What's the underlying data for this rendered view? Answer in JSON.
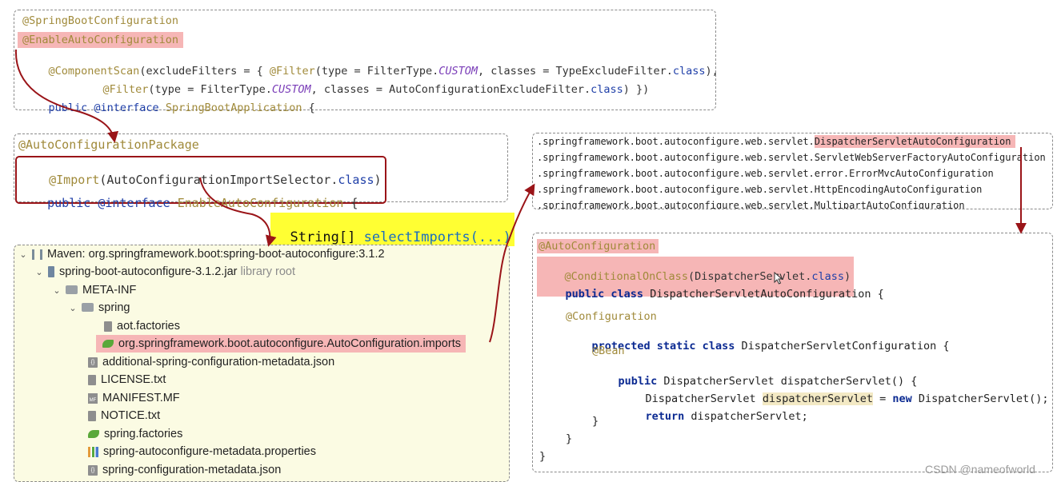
{
  "box1": {
    "ann_springbootconfiguration": "@SpringBootConfiguration",
    "ann_enableautoconfiguration": "@EnableAutoConfiguration",
    "componentscan": {
      "a": "@ComponentScan",
      "b": "(excludeFilters = { ",
      "c": "@Filter",
      "d": "(type = FilterType.",
      "e": "CUSTOM",
      "f": ", classes = TypeExcludeFilter.",
      "g": "class",
      "h": "),"
    },
    "filter2": {
      "a": "@Filter",
      "b": "(type = FilterType.",
      "c": "CUSTOM",
      "d": ", classes = AutoConfigurationExcludeFilter.",
      "e": "class",
      "f": ") })"
    },
    "decl": {
      "a": "public @interface ",
      "b": "SpringBootApplication",
      "c": " {"
    }
  },
  "box2": {
    "ann_package": "@AutoConfigurationPackage",
    "import": {
      "a": "@Import",
      "b": "(AutoConfigurationImportSelector.",
      "c": "class",
      "d": ")"
    },
    "decl": {
      "a": "public @interface ",
      "b": "EnableAutoConfiguration",
      "c": " {"
    }
  },
  "select_imports_label": {
    "a": "String[] ",
    "b": "selectImports(...)"
  },
  "tree": {
    "items": [
      {
        "chev": "⌄",
        "label": "Maven: org.springframework.boot:spring-boot-autoconfigure:3.1.2",
        "extra": ""
      },
      {
        "chev": "⌄",
        "label": "spring-boot-autoconfigure-3.1.2.jar",
        "extra": "library root"
      },
      {
        "chev": "⌄",
        "label": "META-INF",
        "extra": ""
      },
      {
        "chev": "⌄",
        "label": "spring",
        "extra": ""
      },
      {
        "chev": "",
        "label": "aot.factories",
        "extra": ""
      },
      {
        "chev": "",
        "label": "org.springframework.boot.autoconfigure.AutoConfiguration.imports",
        "extra": ""
      },
      {
        "chev": "",
        "label": "additional-spring-configuration-metadata.json",
        "extra": ""
      },
      {
        "chev": "",
        "label": "LICENSE.txt",
        "extra": ""
      },
      {
        "chev": "",
        "label": "MANIFEST.MF",
        "extra": ""
      },
      {
        "chev": "",
        "label": "NOTICE.txt",
        "extra": ""
      },
      {
        "chev": "",
        "label": "spring.factories",
        "extra": ""
      },
      {
        "chev": "",
        "label": "spring-autoconfigure-metadata.properties",
        "extra": ""
      },
      {
        "chev": "",
        "label": "spring-configuration-metadata.json",
        "extra": ""
      }
    ]
  },
  "imports_list": {
    "prefix": ".springframework.boot.autoconfigure.web.servlet.",
    "lines": [
      "DispatcherServletAutoConfiguration",
      "ServletWebServerFactoryAutoConfiguration",
      "error.ErrorMvcAutoConfiguration",
      "HttpEncodingAutoConfiguration",
      "MultipartAutoConfiguration"
    ]
  },
  "box4": {
    "ann_autoconfiguration": "@AutoConfiguration",
    "conditional": {
      "a": "@ConditionalOnClass",
      "b": "(DispatcherServlet.",
      "c": "class",
      "d": ")"
    },
    "class_decl": {
      "a": "public class ",
      "b": "DispatcherServletAutoConfiguration {"
    },
    "configuration_ann": "@Configuration",
    "inner_decl": {
      "a": "protected static class ",
      "b": "DispatcherServletConfiguration {"
    },
    "bean_ann": "@Bean",
    "method_decl": {
      "a": "public ",
      "b": "DispatcherServlet dispatcherServlet() {"
    },
    "assign": {
      "a": "DispatcherServlet ",
      "b": "dispatcherServlet",
      "c": " = ",
      "d": "new",
      "e": " DispatcherServlet();"
    },
    "ret": {
      "a": "return",
      "b": " dispatcherServlet;"
    },
    "brace": "}"
  },
  "watermark": "CSDN @nameofworld",
  "colors": {
    "arrow": "#9a1418",
    "highlight": "#f6b6b6",
    "label_bg": "#ffff33",
    "tree_bg": "#fbfbe3"
  }
}
